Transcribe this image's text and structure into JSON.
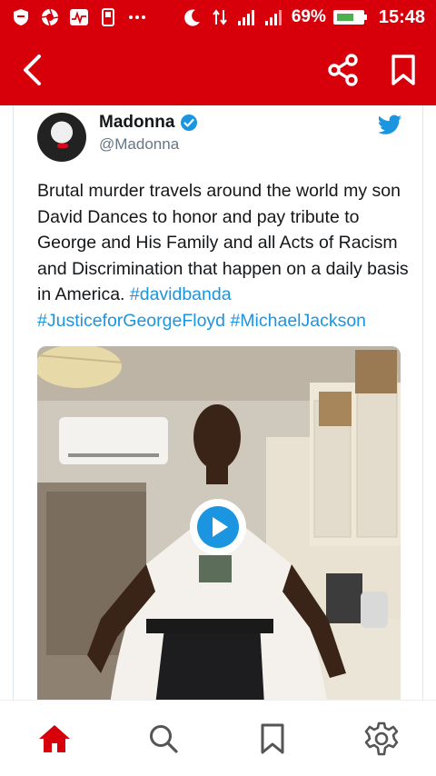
{
  "status_bar": {
    "battery_percent": "69%",
    "time": "15:48",
    "icons": [
      "shield-icon",
      "aperture-icon",
      "activity-icon",
      "phone-icon",
      "more-dots-icon",
      "moon-icon",
      "data-arrows-icon",
      "signal-icon",
      "signal-icon",
      "battery-icon"
    ]
  },
  "app_bar": {
    "back_icon": "chevron-left-icon",
    "share_icon": "share-icon",
    "bookmark_icon": "bookmark-icon"
  },
  "tweet": {
    "display_name": "Madonna",
    "handle": "@Madonna",
    "verified": true,
    "text_plain": "Brutal murder travels around the world my son David Dances to honor and pay tribute to George and His Family and all Acts of Racism and Discrimination that happen on a daily basis in America. ",
    "hashtags": [
      "#davidbanda",
      "#JusticeforGeorgeFloyd",
      "#MichaelJackson"
    ],
    "media_type": "video"
  },
  "bottom_nav": {
    "items": [
      "home-icon",
      "search-icon",
      "bookmark-icon",
      "settings-icon"
    ]
  },
  "colors": {
    "brand_red": "#d7000a",
    "twitter_blue": "#1b95e0"
  }
}
